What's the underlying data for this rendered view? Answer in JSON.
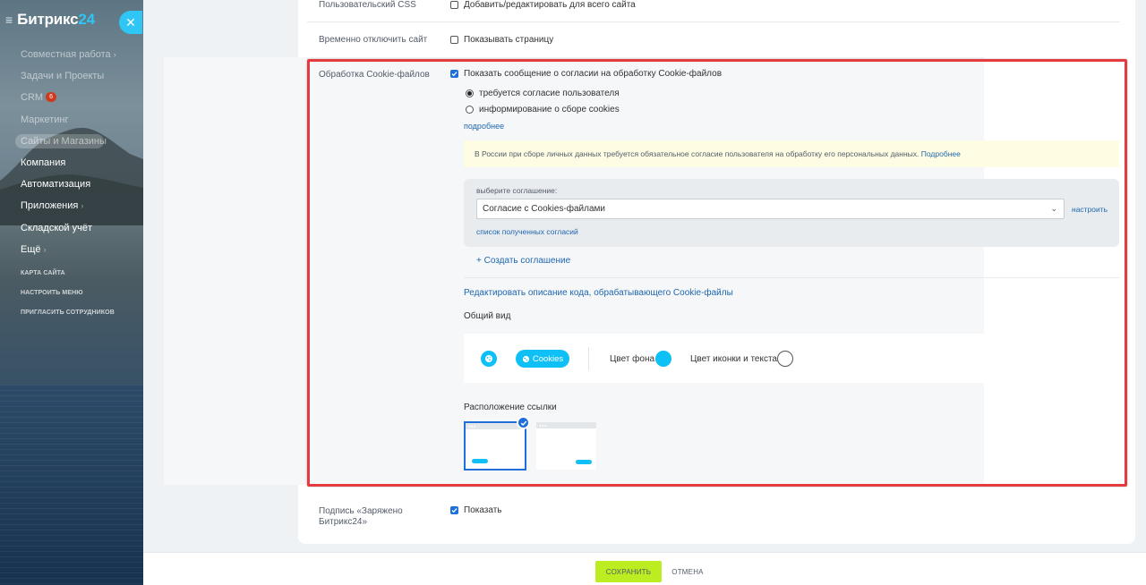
{
  "sidebar": {
    "logo_main": "Битрикс",
    "logo_num": "24",
    "menu": [
      {
        "label": "Совместная работа",
        "chevron": true,
        "bright": false,
        "active": false
      },
      {
        "label": "Задачи и Проекты",
        "chevron": false,
        "bright": false,
        "active": false
      },
      {
        "label": "CRM",
        "badge": "6",
        "chevron": false,
        "bright": false,
        "active": false
      },
      {
        "label": "Маркетинг",
        "chevron": false,
        "bright": false,
        "active": false
      },
      {
        "label": "Сайты и Магазины",
        "chevron": false,
        "bright": false,
        "active": true
      },
      {
        "label": "Компания",
        "chevron": false,
        "bright": true,
        "active": false
      },
      {
        "label": "Автоматизация",
        "chevron": false,
        "bright": true,
        "active": false
      },
      {
        "label": "Приложения",
        "chevron": true,
        "bright": true,
        "active": false
      },
      {
        "label": "Складской учёт",
        "chevron": false,
        "bright": true,
        "active": false
      },
      {
        "label": "Ещё",
        "chevron": true,
        "bright": true,
        "active": false
      }
    ],
    "small_links": [
      "КАРТА САЙТА",
      "НАСТРОИТЬ МЕНЮ",
      "ПРИГЛАСИТЬ СОТРУДНИКОВ"
    ]
  },
  "settings": {
    "custom_css": {
      "label": "Пользовательский CSS",
      "option": "Добавить/редактировать для всего сайта",
      "checked": false
    },
    "disable_site": {
      "label": "Временно отключить сайт",
      "option": "Показывать страницу",
      "checked": false
    },
    "cookies": {
      "label": "Обработка Cookie-файлов",
      "show_consent": "Показать сообщение о согласии на обработку Cookie-файлов",
      "radio_required": "требуется согласие пользователя",
      "radio_inform": "информирование о сборе cookies",
      "more_link": "подробнее",
      "notice_text": "В России при сборе личных данных требуется обязательное согласие пользователя на обработку его персональных данных.",
      "notice_link": "Подробнее",
      "agreement_label": "выберите соглашение:",
      "agreement_value": "Согласие с Cookies-файлами",
      "configure_link": "настроить",
      "received_list_link": "список полученных согласий",
      "create_agreement": "+ Создать соглашение",
      "edit_code_link": "Редактировать описание кода, обрабатывающего Cookie-файлы",
      "general_view": "Общий вид",
      "pill_label": "Cookies",
      "bg_color_label": "Цвет фона",
      "bg_color": "#0ec0f6",
      "icon_color_label": "Цвет иконки и текста",
      "icon_color": "#ffffff",
      "link_position_label": "Расположение ссылки",
      "link_position_selected": "left"
    },
    "powered_by": {
      "label": "Подпись «Заряжено Битрикс24»",
      "option": "Показать",
      "checked": true
    }
  },
  "footer": {
    "save": "СОХРАНИТЬ",
    "cancel": "ОТМЕНА"
  },
  "colors": {
    "accent": "#2fc6f6",
    "save_green": "#bbed21",
    "highlight_red": "#e33b40",
    "link_blue": "#2067b0"
  }
}
